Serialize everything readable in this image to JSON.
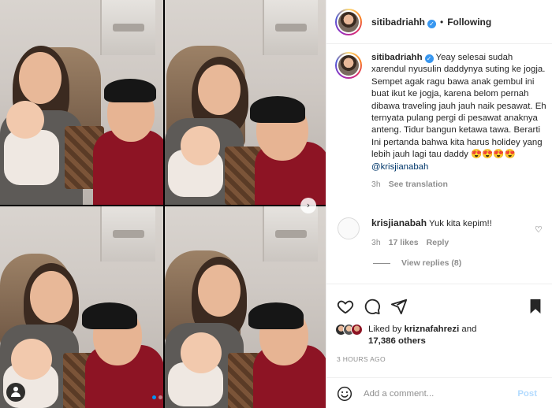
{
  "post": {
    "username": "sitibadriahh",
    "follow_status": "Following",
    "bullet": "•",
    "verified_glyph": "✓",
    "caption_text": "Yeay selesai sudah xarendul nyusulin daddynya suting ke jogja. Sempet agak ragu bawa anak gembul ini buat ikut ke jogja, karena belom pernah dibawa traveling jauh jauh naik pesawat. Eh ternyata pulang pergi di pesawat anaknya anteng. Tidur bangun ketawa tawa. Berarti Ini pertanda bahwa kita harus holidey yang lebih jauh lagi tau daddy 😍😍😍😍",
    "caption_mention": "@krisjianabah",
    "caption_time": "3h",
    "see_translation": "See translation"
  },
  "comment": {
    "username": "krisjianabah",
    "text": "Yuk kita kepim!!",
    "time": "3h",
    "likes": "17 likes",
    "reply_label": "Reply",
    "heart_glyph": "♡",
    "view_replies": "View replies (8)"
  },
  "likes": {
    "prefix": "Liked by",
    "user": "kriznafahrezi",
    "joiner": "and",
    "count": "17,386 others",
    "timestamp": "3 HOURS AGO"
  },
  "add_comment": {
    "placeholder": "Add a comment...",
    "post_label": "Post"
  },
  "carousel": {
    "next_glyph": "›",
    "current_index": 1,
    "total": 2
  },
  "icons": [
    "heart-icon",
    "comment-icon",
    "share-icon",
    "bookmark-icon",
    "emoji-icon",
    "user-tag-icon",
    "verified-icon",
    "chevron-right-icon"
  ],
  "colors": {
    "link": "#00376b",
    "verified": "#3897f0",
    "muted": "#8e8e8e",
    "post_disabled": "#b3dbff",
    "carousel_active": "#0095f6"
  }
}
